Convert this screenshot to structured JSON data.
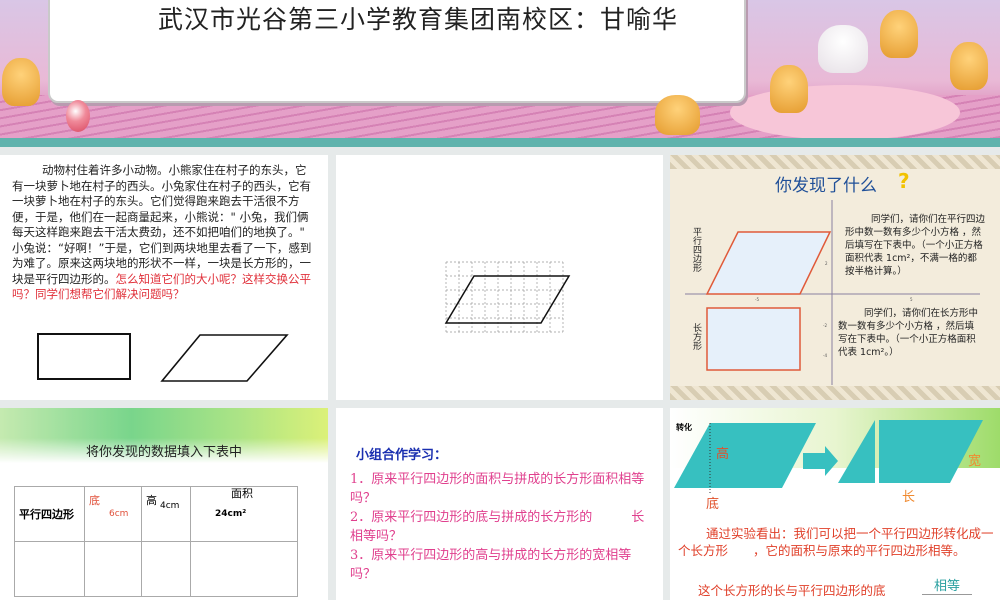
{
  "header": {
    "title": "武汉市光谷第三小学教育集团南校区：甘喻华"
  },
  "slide1": {
    "story": "动物村住着许多小动物。小熊家住在村子的东头，它有一块萝卜地在村子的西头。小兔家住在村子的西头，它有一块萝卜地在村子的东头。它们觉得跑来跑去干活很不方便，于是，他们在一起商量起来，小熊说：\" 小兔，我们俩每天这样跑来跑去干活太费劲，还不如把咱们的地换了。\" 小兔说：“好啊！”于是，它们到两块地里去看了一下，感到为难了。原来这两块地的形状不一样，一块是长方形的，一块是平行四边形的。",
    "question": "怎么知道它们的大小呢？这样交换公平吗？同学们想帮它们解决问题吗？"
  },
  "slide3": {
    "title": "你发现了什么",
    "label_parallelogram": "平行四边形",
    "label_rectangle": "长方形",
    "text1": "同学们，请你们在平行四边形中数一数有多少个小方格 ，然后填写在下表中。（一个小正方格面积代表 1cm²，不满一格的都按半格计算。）",
    "text2": "同学们，请你们在长方形中数一数有多少个小方格 ，然后填写在下表中。（一个小正方格面积代表 1cm²。）",
    "axis_ticks": [
      "-5",
      "5",
      "2",
      "-2",
      "-4"
    ]
  },
  "slide4": {
    "title": "将你发现的数据填入下表中",
    "table": {
      "row_label": "平行四边形",
      "base_label": "底",
      "base_value": "6cm",
      "height_label": "高",
      "height_value": "4cm",
      "area_label": "面积",
      "area_value": "24cm²"
    }
  },
  "slide5": {
    "heading": "小组合作学习：",
    "questions": [
      "1．原来平行四边形的面积与拼成的长方形面积相等吗？",
      "2．原来平行四边形的底与拼成的长方形的　　　长相等吗？",
      "3．原来平行四边形的高与拼成的长方形的宽相等吗？"
    ]
  },
  "slide6": {
    "tag": "转化",
    "height": "高",
    "base": "底",
    "width": "宽",
    "length": "长",
    "conclusion": "通过实验看出：我们可以把一个平行四边形转化成一个长方形　　，它的面积与原来的平行四边形相等。",
    "line2": "这个长方形的长与平行四边形的底",
    "answer": "相等"
  }
}
